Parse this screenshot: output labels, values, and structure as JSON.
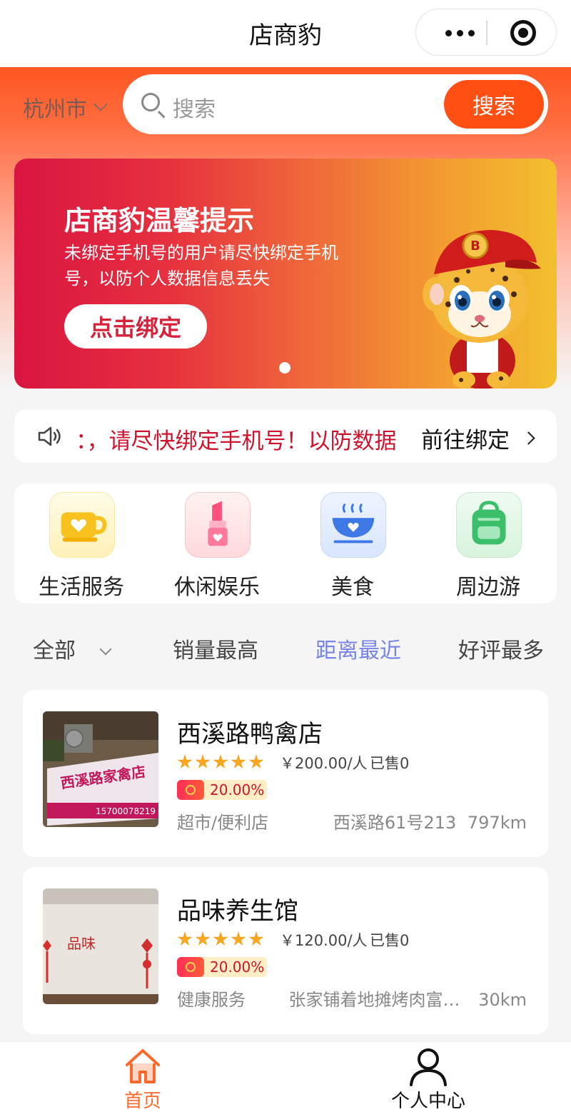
{
  "navbar": {
    "title": "店商豹",
    "more_icon": "more-dots-icon",
    "capsule_icon": "target-icon"
  },
  "header": {
    "city": "杭州市",
    "search_placeholder": "搜索",
    "search_button": "搜索"
  },
  "banner": {
    "title": "店商豹温馨提示",
    "desc": "未绑定手机号的用户请尽快绑定手机号，以防个人数据信息丢失",
    "button": "点击绑定",
    "mascot_icon": "leopard-mascot-icon",
    "active_slide": 1,
    "slide_count": 1
  },
  "notice": {
    "text": "：，请尽快绑定手机号！以防数据",
    "action": "前往绑定"
  },
  "categories": [
    {
      "label": "生活服务",
      "icon": "coffee-cup-heart-icon"
    },
    {
      "label": "休闲娱乐",
      "icon": "lipstick-icon"
    },
    {
      "label": "美食",
      "icon": "bowl-icon"
    },
    {
      "label": "周边游",
      "icon": "backpack-icon"
    }
  ],
  "filters": [
    {
      "label": "全部",
      "active": false
    },
    {
      "label": "销量最高",
      "active": false
    },
    {
      "label": "距离最近",
      "active": true
    },
    {
      "label": "好评最多",
      "active": false
    }
  ],
  "stores": [
    {
      "name": "西溪路鸭禽店",
      "rating": 5,
      "price": "￥200.00/人",
      "sold": "已售0",
      "discount": "20.00%",
      "category": "超市/便利店",
      "address": "西溪路61号213",
      "distance": "797km",
      "thumb_sign": "西溪路家禽店",
      "thumb_phone": "15700078219"
    },
    {
      "name": "品味养生馆",
      "rating": 5,
      "price": "￥120.00/人",
      "sold": "已售0",
      "discount": "20.00%",
      "category": "健康服务",
      "address": "张家铺着地摊烤肉富…",
      "distance": "30km",
      "thumb_sign": "品味"
    }
  ],
  "tabbar": [
    {
      "label": "首页",
      "icon": "home-icon",
      "active": true
    },
    {
      "label": "个人中心",
      "icon": "user-icon",
      "active": false
    }
  ],
  "colors": {
    "accent": "#ff4f12",
    "active_tab": "#ff6a2c",
    "active_filter": "#7884e6",
    "notice_text": "#d0132c"
  }
}
